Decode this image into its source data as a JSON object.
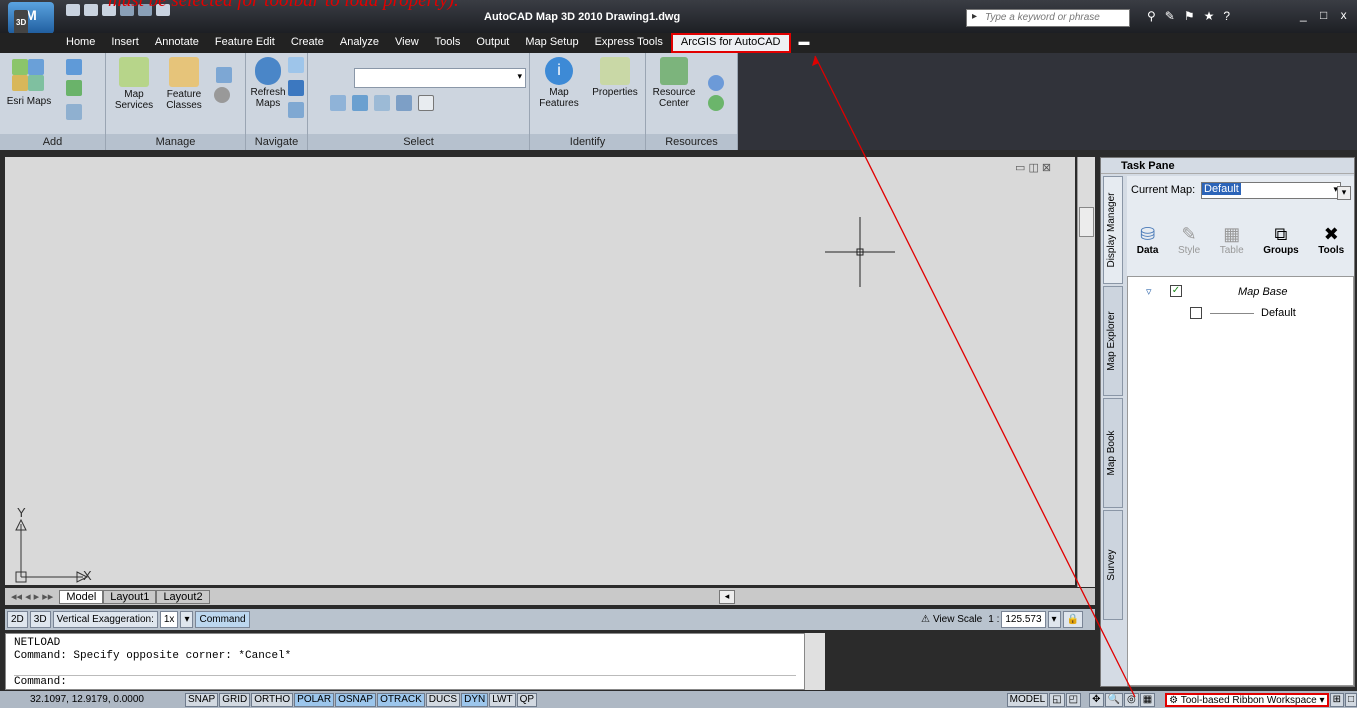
{
  "annotation": "must be selected for toolbar to load property).",
  "titlebar": {
    "app_badge": "3D",
    "title": "AutoCAD Map 3D 2010    Drawing1.dwg",
    "search_placeholder": "Type a keyword or phrase",
    "win_controls": "_ □ x"
  },
  "tabs": [
    "Home",
    "Insert",
    "Annotate",
    "Feature Edit",
    "Create",
    "Analyze",
    "View",
    "Tools",
    "Output",
    "Map Setup",
    "Express Tools",
    "ArcGIS for AutoCAD"
  ],
  "ribbon": {
    "add": {
      "footer": "Add",
      "esri_maps": "Esri Maps"
    },
    "manage": {
      "footer": "Manage",
      "map_services": "Map Services",
      "feature_classes": "Feature Classes"
    },
    "navigate": {
      "footer": "Navigate",
      "refresh_maps": "Refresh Maps"
    },
    "select": {
      "footer": "Select"
    },
    "identify": {
      "footer": "Identify",
      "map_features": "Map Features",
      "properties": "Properties"
    },
    "resources": {
      "footer": "Resources",
      "resource_center": "Resource Center"
    }
  },
  "layout_tabs": [
    "Model",
    "Layout1",
    "Layout2"
  ],
  "status_a": {
    "b2d": "2D",
    "b3d": "3D",
    "vert_exag": "Vertical Exaggeration:",
    "vert_exag_val": "1x",
    "command": "Command",
    "view_scale": "View Scale",
    "scale_prefix": "1 :",
    "scale_val": "125.573"
  },
  "command_lines": [
    "NETLOAD",
    "Command: Specify opposite corner: *Cancel*",
    "",
    "Command:"
  ],
  "status_b": {
    "coords": "32.1097, 12.9179, 0.0000",
    "toggles": [
      "SNAP",
      "GRID",
      "ORTHO",
      "POLAR",
      "OSNAP",
      "OTRACK",
      "DUCS",
      "DYN",
      "LWT",
      "QP"
    ],
    "model": "MODEL",
    "workspace": "Tool-based Ribbon Workspace"
  },
  "taskpane": {
    "title": "Task Pane",
    "current_map_label": "Current Map:",
    "current_map_value": "Default",
    "side_tabs": [
      "Display Manager",
      "Map Explorer",
      "Map Book",
      "Survey"
    ],
    "tools": [
      "Data",
      "Style",
      "Table",
      "Groups",
      "Tools"
    ],
    "layer_group": "Map Base",
    "layer": "Default"
  },
  "canvas": {
    "ucs_y": "Y",
    "ucs_x": "X"
  }
}
